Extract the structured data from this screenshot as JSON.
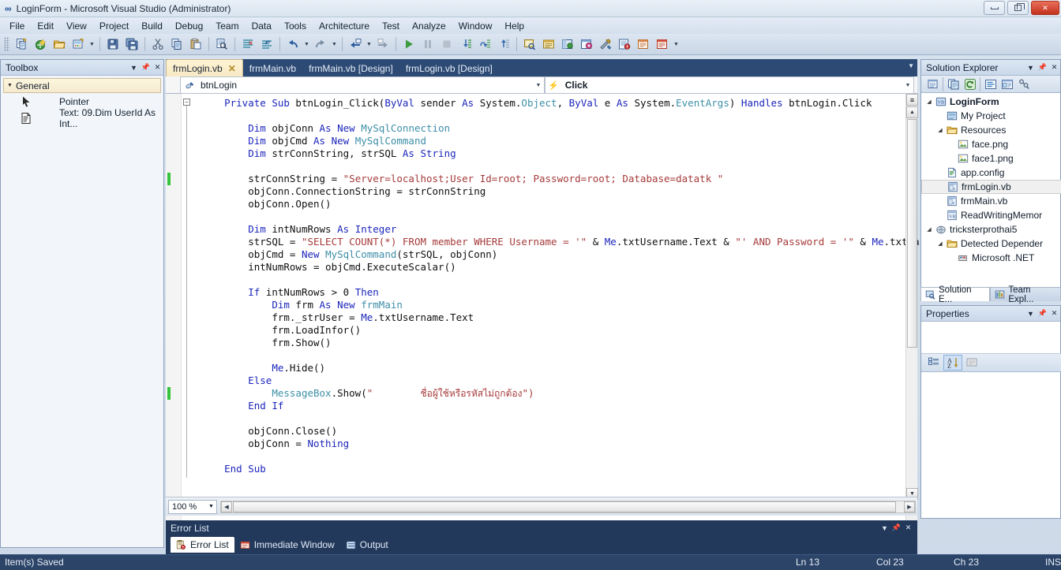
{
  "window": {
    "title": "LoginForm - Microsoft Visual Studio (Administrator)",
    "app_icon": "visual-studio-icon",
    "minimize": "minimize-icon",
    "restore": "restore-icon",
    "close": "close-icon"
  },
  "menubar": {
    "items": [
      "File",
      "Edit",
      "View",
      "Project",
      "Build",
      "Debug",
      "Team",
      "Data",
      "Tools",
      "Architecture",
      "Test",
      "Analyze",
      "Window",
      "Help"
    ]
  },
  "toolbar": {
    "buttons": [
      "new-project-icon",
      "add-new-item-icon",
      "open-file-icon",
      "add-existing-item-icon",
      "save-icon",
      "save-all-icon",
      "cut-icon",
      "copy-icon",
      "paste-icon",
      "find-icon",
      "comment-icon",
      "uncomment-icon",
      "undo-icon",
      "redo-icon",
      "navigate-backward-icon",
      "navigate-forward-icon",
      "start-debugging-icon",
      "pause-icon",
      "stop-icon",
      "step-into-icon",
      "step-over-icon",
      "step-out-icon",
      "solution-explorer-icon",
      "properties-window-icon",
      "object-browser-icon",
      "toolbox-icon",
      "tools-icon",
      "error-list-icon",
      "output-icon",
      "immediate-window-icon"
    ],
    "overflow_label": "toolbar-overflow-icon"
  },
  "toolbox": {
    "title": "Toolbox",
    "dropdown": "chevron-down-icon",
    "pin": "pin-icon",
    "close": "close-icon",
    "group": "General",
    "items": [
      {
        "label": "Pointer",
        "icon": "pointer-icon"
      },
      {
        "label": "Text: 09.Dim UserId As Int...",
        "icon": "text-snippet-icon"
      }
    ]
  },
  "editor": {
    "tabs": [
      {
        "label": "frmLogin.vb",
        "active": true,
        "closable": true
      },
      {
        "label": "frmMain.vb",
        "active": false,
        "closable": false
      },
      {
        "label": "frmMain.vb [Design]",
        "active": false,
        "closable": false
      },
      {
        "label": "frmLogin.vb [Design]",
        "active": false,
        "closable": false
      }
    ],
    "tab_overflow": "chevron-down-icon",
    "member_dropdown": "btnLogin",
    "event_dropdown": "Click",
    "event_icon": "lightning-bolt-icon",
    "object_icon": "object-icon",
    "zoom": "100 %",
    "code_lines": [
      {
        "indent": 4,
        "fold": "collapse",
        "segments": [
          {
            "t": "Private Sub ",
            "c": "kw"
          },
          {
            "t": "btnLogin_Click(",
            "c": ""
          },
          {
            "t": "ByVal ",
            "c": "kw"
          },
          {
            "t": "sender ",
            "c": ""
          },
          {
            "t": "As ",
            "c": "kw"
          },
          {
            "t": "System.",
            "c": ""
          },
          {
            "t": "Object",
            "c": "type"
          },
          {
            "t": ", ",
            "c": ""
          },
          {
            "t": "ByVal ",
            "c": "kw"
          },
          {
            "t": "e ",
            "c": ""
          },
          {
            "t": "As ",
            "c": "kw"
          },
          {
            "t": "System.",
            "c": ""
          },
          {
            "t": "EventArgs",
            "c": "type"
          },
          {
            "t": ") ",
            "c": ""
          },
          {
            "t": "Handles ",
            "c": "kw"
          },
          {
            "t": "btnLogin.Click",
            "c": ""
          }
        ]
      },
      {
        "indent": 0,
        "segments": []
      },
      {
        "indent": 8,
        "segments": [
          {
            "t": "Dim ",
            "c": "kw"
          },
          {
            "t": "objConn ",
            "c": ""
          },
          {
            "t": "As New ",
            "c": "kw"
          },
          {
            "t": "MySqlConnection",
            "c": "type"
          }
        ]
      },
      {
        "indent": 8,
        "segments": [
          {
            "t": "Dim ",
            "c": "kw"
          },
          {
            "t": "objCmd ",
            "c": ""
          },
          {
            "t": "As New ",
            "c": "kw"
          },
          {
            "t": "MySqlCommand",
            "c": "type"
          }
        ]
      },
      {
        "indent": 8,
        "segments": [
          {
            "t": "Dim ",
            "c": "kw"
          },
          {
            "t": "strConnString, strSQL ",
            "c": ""
          },
          {
            "t": "As String",
            "c": "kw"
          }
        ]
      },
      {
        "indent": 0,
        "segments": []
      },
      {
        "indent": 8,
        "change": true,
        "segments": [
          {
            "t": "strConnString = ",
            "c": ""
          },
          {
            "t": "\"Server=localhost;User Id=root; Password=root; Database=datatk \"",
            "c": "str"
          }
        ]
      },
      {
        "indent": 8,
        "segments": [
          {
            "t": "objConn.ConnectionString = strConnString",
            "c": ""
          }
        ]
      },
      {
        "indent": 8,
        "segments": [
          {
            "t": "objConn.Open()",
            "c": ""
          }
        ]
      },
      {
        "indent": 0,
        "segments": []
      },
      {
        "indent": 8,
        "segments": [
          {
            "t": "Dim ",
            "c": "kw"
          },
          {
            "t": "intNumRows ",
            "c": ""
          },
          {
            "t": "As Integer",
            "c": "kw"
          }
        ]
      },
      {
        "indent": 8,
        "segments": [
          {
            "t": "strSQL = ",
            "c": ""
          },
          {
            "t": "\"SELECT COUNT(*) FROM member WHERE Username = '\"",
            "c": "str"
          },
          {
            "t": " & ",
            "c": ""
          },
          {
            "t": "Me",
            "c": "kw"
          },
          {
            "t": ".txtUsername.Text & ",
            "c": ""
          },
          {
            "t": "\"' AND Password = '\"",
            "c": "str"
          },
          {
            "t": " & ",
            "c": ""
          },
          {
            "t": "Me",
            "c": "kw"
          },
          {
            "t": ".txtPassword.",
            "c": ""
          }
        ]
      },
      {
        "indent": 8,
        "segments": [
          {
            "t": "objCmd = ",
            "c": ""
          },
          {
            "t": "New ",
            "c": "kw"
          },
          {
            "t": "MySqlCommand",
            "c": "type"
          },
          {
            "t": "(strSQL, objConn)",
            "c": ""
          }
        ]
      },
      {
        "indent": 8,
        "segments": [
          {
            "t": "intNumRows = objCmd.ExecuteScalar()",
            "c": ""
          }
        ]
      },
      {
        "indent": 0,
        "segments": []
      },
      {
        "indent": 8,
        "segments": [
          {
            "t": "If ",
            "c": "kw"
          },
          {
            "t": "intNumRows > ",
            "c": ""
          },
          {
            "t": "0",
            "c": "num"
          },
          {
            "t": " ",
            "c": ""
          },
          {
            "t": "Then",
            "c": "kw"
          }
        ]
      },
      {
        "indent": 12,
        "segments": [
          {
            "t": "Dim ",
            "c": "kw"
          },
          {
            "t": "frm ",
            "c": ""
          },
          {
            "t": "As New ",
            "c": "kw"
          },
          {
            "t": "frmMain",
            "c": "type"
          }
        ]
      },
      {
        "indent": 12,
        "segments": [
          {
            "t": "frm._strUser = ",
            "c": ""
          },
          {
            "t": "Me",
            "c": "kw"
          },
          {
            "t": ".txtUsername.Text",
            "c": ""
          }
        ]
      },
      {
        "indent": 12,
        "segments": [
          {
            "t": "frm.LoadInfor()",
            "c": ""
          }
        ]
      },
      {
        "indent": 12,
        "segments": [
          {
            "t": "frm.Show()",
            "c": ""
          }
        ]
      },
      {
        "indent": 0,
        "segments": []
      },
      {
        "indent": 12,
        "segments": [
          {
            "t": "Me",
            "c": "kw"
          },
          {
            "t": ".Hide()",
            "c": ""
          }
        ]
      },
      {
        "indent": 8,
        "segments": [
          {
            "t": "Else",
            "c": "kw"
          }
        ]
      },
      {
        "indent": 12,
        "change": true,
        "segments": [
          {
            "t": "MessageBox",
            "c": "type"
          },
          {
            "t": ".Show(",
            "c": ""
          },
          {
            "t": "\"        ",
            "c": "str"
          },
          {
            "t": "ชื่อผู้ใช้หรือรหัสไม่ถูกต้อง",
            "c": "thai"
          },
          {
            "t": "\")",
            "c": "str"
          }
        ]
      },
      {
        "indent": 8,
        "segments": [
          {
            "t": "End If",
            "c": "kw"
          }
        ]
      },
      {
        "indent": 0,
        "segments": []
      },
      {
        "indent": 8,
        "segments": [
          {
            "t": "objConn.Close()",
            "c": ""
          }
        ]
      },
      {
        "indent": 8,
        "segments": [
          {
            "t": "objConn = ",
            "c": ""
          },
          {
            "t": "Nothing",
            "c": "kw"
          }
        ]
      },
      {
        "indent": 0,
        "segments": []
      },
      {
        "indent": 4,
        "segments": [
          {
            "t": "End Sub",
            "c": "kw"
          }
        ]
      }
    ]
  },
  "solution_explorer": {
    "title": "Solution Explorer",
    "dropdown": "chevron-down-icon",
    "pin": "pin-icon",
    "close": "close-icon",
    "toolbar_buttons": [
      "properties-icon",
      "show-all-files-icon",
      "refresh-icon",
      "view-code-icon",
      "view-designer-icon",
      "class-view-icon"
    ],
    "tree": [
      {
        "label": "LoginForm",
        "depth": 0,
        "twisty": "expanded",
        "icon": "project-icon",
        "bold": true
      },
      {
        "label": "My Project",
        "depth": 1,
        "twisty": "",
        "icon": "my-project-icon"
      },
      {
        "label": "Resources",
        "depth": 1,
        "twisty": "expanded",
        "icon": "folder-icon"
      },
      {
        "label": "face.png",
        "depth": 2,
        "twisty": "",
        "icon": "image-file-icon"
      },
      {
        "label": "face1.png",
        "depth": 2,
        "twisty": "",
        "icon": "image-file-icon"
      },
      {
        "label": "app.config",
        "depth": 1,
        "twisty": "",
        "icon": "config-file-icon"
      },
      {
        "label": "frmLogin.vb",
        "depth": 1,
        "twisty": "",
        "icon": "form-file-icon",
        "selected": true
      },
      {
        "label": "frmMain.vb",
        "depth": 1,
        "twisty": "",
        "icon": "form-file-icon"
      },
      {
        "label": "ReadWritingMemor",
        "depth": 1,
        "twisty": "",
        "icon": "vb-file-icon"
      },
      {
        "label": "tricksterprothai5",
        "depth": 0,
        "twisty": "expanded",
        "icon": "web-project-icon"
      },
      {
        "label": "Detected Depender",
        "depth": 1,
        "twisty": "expanded",
        "icon": "folder-icon"
      },
      {
        "label": "Microsoft .NET",
        "depth": 2,
        "twisty": "",
        "icon": "reference-icon"
      }
    ],
    "tabs": [
      {
        "label": "Solution E...",
        "icon": "solution-explorer-icon",
        "active": true
      },
      {
        "label": "Team Expl...",
        "icon": "team-explorer-icon",
        "active": false
      }
    ]
  },
  "properties": {
    "title": "Properties",
    "dropdown": "chevron-down-icon",
    "pin": "pin-icon",
    "close": "close-icon",
    "toolbar_buttons": [
      "categorized-icon",
      "alphabetical-icon",
      "property-pages-icon"
    ]
  },
  "error_list": {
    "title": "Error List",
    "dropdown": "chevron-down-icon",
    "pin": "pin-icon",
    "close": "close-icon",
    "tabs": [
      {
        "label": "Error List",
        "icon": "error-list-icon",
        "active": true
      },
      {
        "label": "Immediate Window",
        "icon": "immediate-window-icon",
        "active": false
      },
      {
        "label": "Output",
        "icon": "output-icon",
        "active": false
      }
    ]
  },
  "statusbar": {
    "message": "Item(s) Saved",
    "line": "Ln 13",
    "column": "Col 23",
    "character": "Ch 23",
    "insert_mode": "INS"
  },
  "colors": {
    "chrome_dark": "#23395b",
    "status_bar": "#2b4468",
    "accent_tab": "#fdf3d5",
    "keyword": "#1c26bb",
    "type": "#3e8fa8",
    "string": "#a63a3a",
    "change_marker": "#35c43b"
  }
}
